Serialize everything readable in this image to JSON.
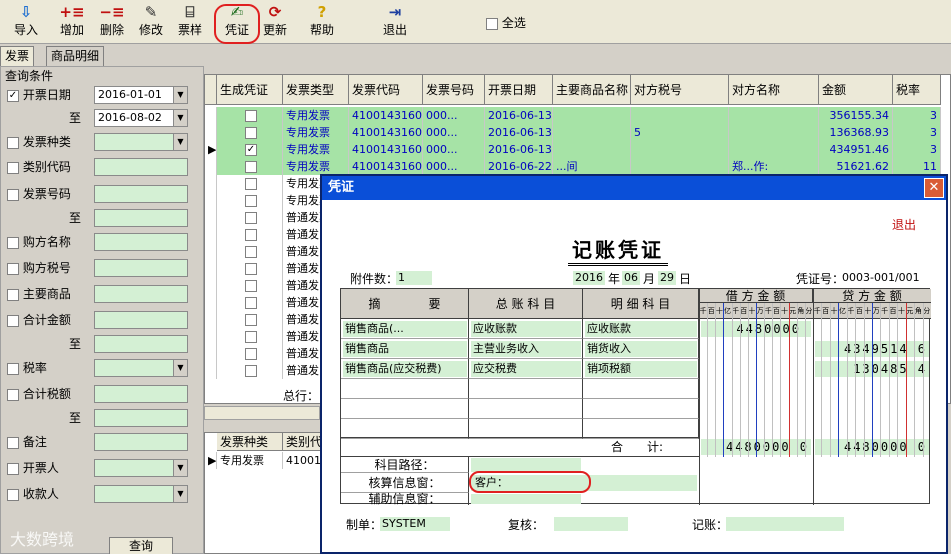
{
  "toolbar": {
    "import": "导入",
    "add": "增加",
    "delete": "删除",
    "modify": "修改",
    "sample": "票样",
    "voucher": "凭证",
    "update": "更新",
    "help": "帮助",
    "exit": "退出",
    "select_all": "全选"
  },
  "tabs": [
    "发票",
    "商品明细"
  ],
  "query": {
    "title": "查询条件",
    "date_label": "开票日期",
    "date_from": "2016-01-01",
    "to": "至",
    "date_to": "2016-08-02",
    "invoice_type": "发票种类",
    "category_code": "类别代码",
    "invoice_no": "发票号码",
    "buyer_name": "购方名称",
    "buyer_tax": "购方税号",
    "main_goods": "主要商品",
    "total_amount": "合计金额",
    "tax_rate": "税率",
    "total_tax": "合计税额",
    "remark": "备注",
    "issuer": "开票人",
    "payee": "收款人",
    "query_button": "查询"
  },
  "grid": {
    "headers": [
      "生成凭证",
      "发票类型",
      "发票代码",
      "发票号码",
      "开票日期",
      "主要商品名称",
      "对方税号",
      "对方名称",
      "金额",
      "税率"
    ],
    "rows": [
      {
        "type": "专用发票",
        "code": "4100143160",
        "no": "000...",
        "date": "2016-06-13",
        "goods": "",
        "tax": "",
        "name": "",
        "amount": "356155.34",
        "rate": "3"
      },
      {
        "type": "专用发票",
        "code": "4100143160",
        "no": "000...",
        "date": "2016-06-13",
        "goods": "",
        "tax": "5",
        "name": "",
        "amount": "136368.93",
        "rate": "3"
      },
      {
        "type": "专用发票",
        "code": "4100143160",
        "no": "000...",
        "date": "2016-06-13",
        "goods": "",
        "tax": "",
        "name": "",
        "amount": "434951.46",
        "rate": "3"
      },
      {
        "type": "专用发票",
        "code": "4100143160",
        "no": "000...",
        "date": "2016-06-22",
        "goods": "...间",
        "tax": "",
        "name": "郑...作:",
        "amount": "51621.62",
        "rate": "11"
      },
      {
        "type": "专用发票"
      },
      {
        "type": "专用发票"
      },
      {
        "type": "普通发票"
      },
      {
        "type": "普通发"
      },
      {
        "type": "普通发"
      },
      {
        "type": "普通发"
      },
      {
        "type": "普通发"
      },
      {
        "type": "普通发"
      },
      {
        "type": "普通发"
      },
      {
        "type": "普通发"
      },
      {
        "type": "普通发"
      },
      {
        "type": "普通发"
      }
    ],
    "total_label": "总行："
  },
  "bottom_grid": {
    "headers": [
      "发票种类",
      "类别代"
    ],
    "row": {
      "type": "专用发票",
      "code": "410014"
    }
  },
  "dialog": {
    "title": "凭证",
    "exit": "退出",
    "heading": "记账凭证",
    "attach_label": "附件数：",
    "attach_value": "1",
    "year": "2016",
    "year_label": "年",
    "month": "06",
    "month_label": "月",
    "day": "29",
    "day_label": "日",
    "voucher_no_label": "凭证号：",
    "voucher_no": "0003-001/001",
    "col_summary": "摘　　　　要",
    "col_account": "总 账 科 目",
    "col_detail": "明 细 科 目",
    "col_debit": "借 方 金 额",
    "col_credit": "贷 方 金 额",
    "digits": [
      "千",
      "百",
      "十",
      "亿",
      "千",
      "百",
      "十",
      "万",
      "千",
      "百",
      "十",
      "元",
      "角",
      "分"
    ],
    "lines": [
      {
        "summary": "销售商品(...",
        "account": "应收账款",
        "detail": "应收账款",
        "debit": "4480000",
        "credit": ""
      },
      {
        "summary": "销售商品",
        "account": "主营业务收入",
        "detail": "销货收入",
        "debit": "",
        "credit": "4349514 6"
      },
      {
        "summary": "销售商品(应交税费)",
        "account": "应交税费",
        "detail": "销项税额",
        "debit": "",
        "credit": "130485 4"
      }
    ],
    "total_label": "合　　计:",
    "total_debit": "4480000 0",
    "total_credit": "4480000 0",
    "path_label": "科目路径：",
    "check_label": "核算信息窗：",
    "check_value": "客户：",
    "aux_label": "辅助信息窗：",
    "maker_label": "制单：",
    "maker": "SYSTEM",
    "review_label": "复核：",
    "book_label": "记账："
  },
  "watermark": "大数跨境"
}
